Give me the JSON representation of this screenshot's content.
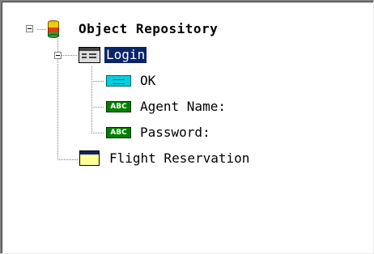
{
  "tree": {
    "root": {
      "label": "Object Repository",
      "icon": "repository-icon"
    },
    "login": {
      "label": "Login",
      "icon": "dialog-icon"
    },
    "ok": {
      "label": "OK",
      "icon": "button-icon"
    },
    "agent_name": {
      "label": "Agent Name:",
      "icon": "edit-field-icon",
      "badge": "ABC"
    },
    "password": {
      "label": "Password:",
      "icon": "edit-field-icon",
      "badge": "ABC"
    },
    "flight_reservation": {
      "label": "Flight Reservation",
      "icon": "window-icon"
    }
  },
  "colors": {
    "selection": "#0a246a",
    "button_icon": "#00d0e0",
    "edit_icon": "#008000",
    "window_icon": "#ffff99"
  }
}
